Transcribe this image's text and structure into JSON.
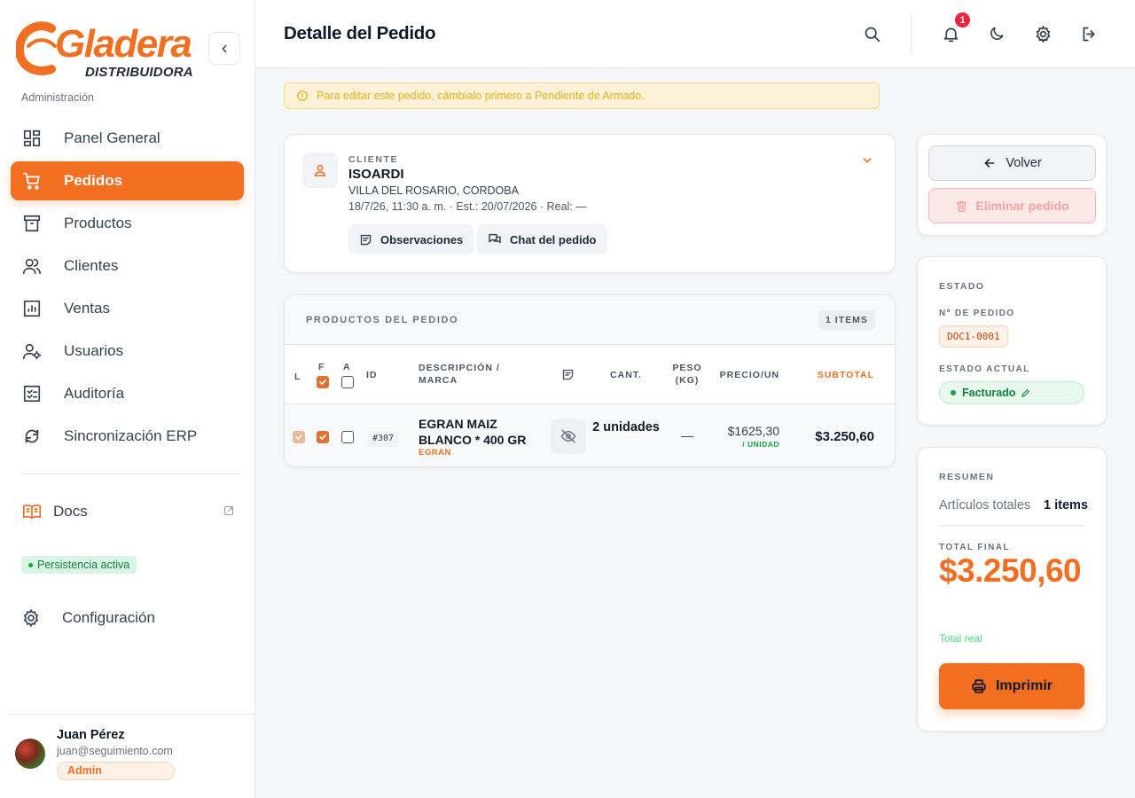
{
  "brand": {
    "name": "Gladera",
    "subtitle": "DISTRIBUIDORA",
    "accent": "#f26f21",
    "section_label": "Administración"
  },
  "sidebar": {
    "items": [
      {
        "label": "Panel General",
        "icon": "dashboard-icon"
      },
      {
        "label": "Pedidos",
        "icon": "cart-icon",
        "active": true
      },
      {
        "label": "Productos",
        "icon": "archive-icon"
      },
      {
        "label": "Clientes",
        "icon": "users-icon"
      },
      {
        "label": "Ventas",
        "icon": "chart-icon"
      },
      {
        "label": "Usuarios",
        "icon": "user-gear-icon"
      },
      {
        "label": "Auditoría",
        "icon": "checklist-icon"
      },
      {
        "label": "Sincronización ERP",
        "icon": "sync-icon"
      }
    ],
    "docs_label": "Docs",
    "persistence_label": "Persistencia activa",
    "config_label": "Configuración"
  },
  "user": {
    "name": "Juan Pérez",
    "email": "juan@seguimiento.com",
    "role": "Admin"
  },
  "header": {
    "title": "Detalle del Pedido",
    "notification_count": "1"
  },
  "alert": {
    "text": "Para editar este pedido, cámbialo primero a Pendiente de Armado."
  },
  "client": {
    "label": "CLIENTE",
    "name": "ISOARDI",
    "location": "VILLA DEL ROSARIO, CORDOBA",
    "dates": "18/7/26, 11:30 a. m. · Est.: 20/07/2026 · Real: —",
    "observations_label": "Observaciones",
    "chat_label": "Chat del pedido"
  },
  "products": {
    "title": "PRODUCTOS DEL PEDIDO",
    "count_badge": "1 ITEMS",
    "columns": {
      "l": "L",
      "f": "F",
      "a": "A",
      "id": "ID",
      "description": "DESCRIPCIÓN / MARCA",
      "qty": "CANT.",
      "weight": "PESO (KG)",
      "price": "PRECIO/UN",
      "subtotal": "SUBTOTAL"
    },
    "rows": [
      {
        "id": "#307",
        "description": "EGRAN MAIZ BLANCO * 400 GR",
        "brand": "EGRAN",
        "qty": "2 unidades",
        "weight": "—",
        "price": "$1625,30",
        "price_unit": "/ UNIDAD",
        "subtotal": "$3.250,60",
        "l_checked": true,
        "f_checked": true,
        "a_checked": false
      }
    ]
  },
  "actions": {
    "back_label": "Volver",
    "delete_label": "Eliminar pedido"
  },
  "estado": {
    "title": "ESTADO",
    "order_no_label": "Nº DE PEDIDO",
    "order_no": "DOC1-0001",
    "current_label": "ESTADO ACTUAL",
    "current": "Facturado"
  },
  "resumen": {
    "title": "RESUMEN",
    "articles_label": "Artículos totales",
    "articles_value": "1 items",
    "total_label": "TOTAL FINAL",
    "total_value": "$3.250,60",
    "total_real": "Total real",
    "print_label": "Imprimir"
  }
}
